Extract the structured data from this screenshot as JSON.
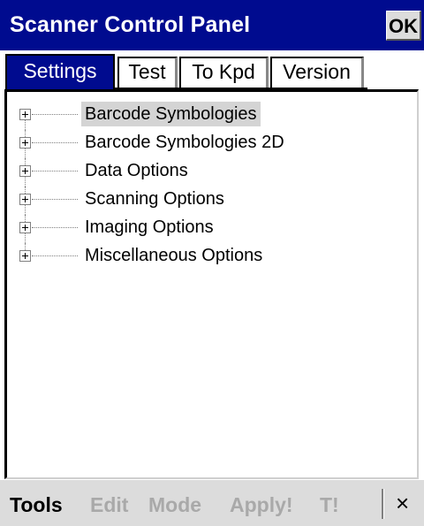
{
  "window": {
    "title": "Scanner Control Panel",
    "ok_label": "OK"
  },
  "tabs": [
    {
      "label": "Settings",
      "selected": true
    },
    {
      "label": "Test",
      "selected": false
    },
    {
      "label": "To Kpd",
      "selected": false
    },
    {
      "label": "Version",
      "selected": false
    }
  ],
  "tree": {
    "items": [
      {
        "label": "Barcode Symbologies",
        "expander": "+",
        "selected": true
      },
      {
        "label": "Barcode Symbologies 2D",
        "expander": "+",
        "selected": false
      },
      {
        "label": "Data Options",
        "expander": "+",
        "selected": false
      },
      {
        "label": "Scanning Options",
        "expander": "+",
        "selected": false
      },
      {
        "label": "Imaging Options",
        "expander": "+",
        "selected": false
      },
      {
        "label": "Miscellaneous Options",
        "expander": "+",
        "selected": false
      }
    ]
  },
  "menubar": {
    "tools": "Tools",
    "edit": "Edit",
    "mode": "Mode",
    "apply": "Apply!",
    "t": "T!",
    "close_glyph": "×"
  },
  "colors": {
    "titlebar": "#000b8f",
    "menu_disabled": "#a9a9a9",
    "selection": "#d4d4d4"
  },
  "icons": {
    "expander": "plus-box-icon",
    "close": "close-icon"
  }
}
